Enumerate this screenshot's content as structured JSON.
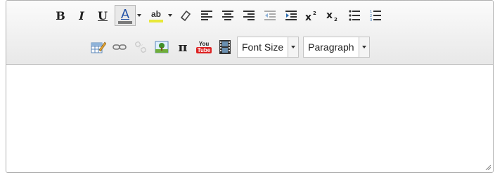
{
  "toolbar": {
    "row1": {
      "bold_label": "B",
      "italic_label": "I",
      "underline_label": "U",
      "text_color_label": "A",
      "highlight_label": "ab",
      "text_color_value": "#7a7a7a",
      "highlight_color_value": "#e8e83a"
    },
    "row2": {
      "youtube_top": "You",
      "youtube_bottom": "Tube",
      "pi_label": "π",
      "font_size_label": "Font Size",
      "paragraph_label": "Paragraph"
    }
  },
  "editor": {
    "content": ""
  }
}
